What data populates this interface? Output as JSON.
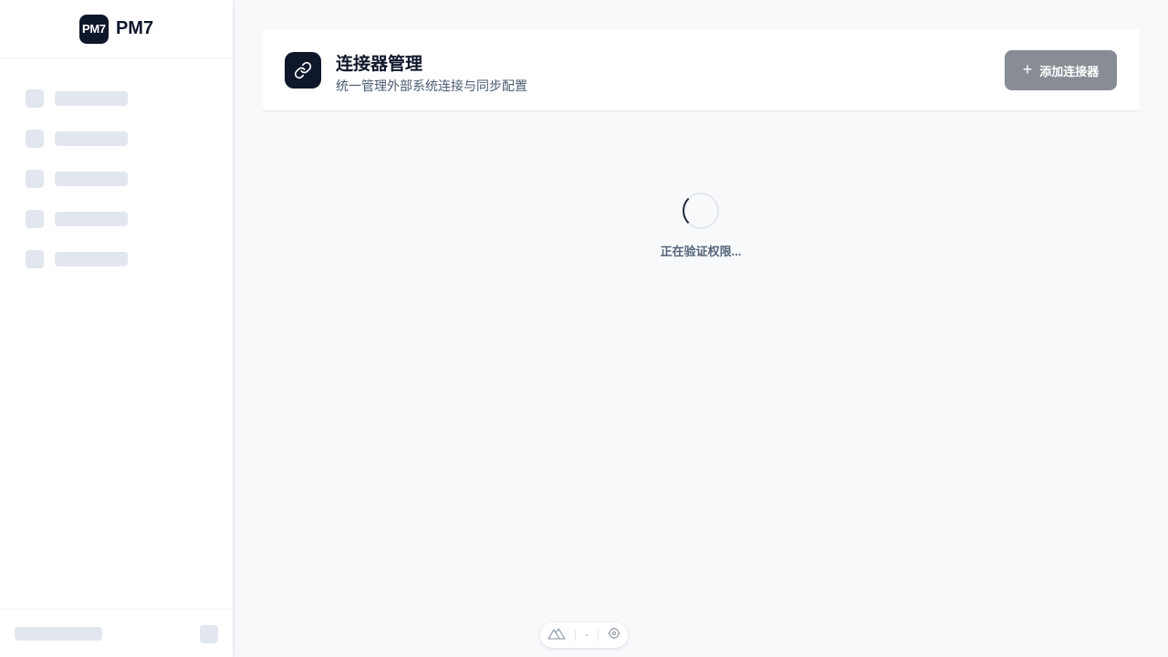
{
  "brand": {
    "logo_text": "PM7",
    "name": "PM7"
  },
  "sidebar": {
    "skeleton_items": 5,
    "loading": true
  },
  "header": {
    "icon": "link-icon",
    "title": "连接器管理",
    "subtitle": "统一管理外部系统连接与同步配置",
    "add_button_label": "添加连接器",
    "add_button_icon": "plus-icon"
  },
  "loading": {
    "text": "正在验证权限..."
  },
  "devbar": {
    "value": "-",
    "icons": [
      "nuxt-icon",
      "target-icon"
    ]
  },
  "colors": {
    "accent_dark": "#0f172a",
    "button_disabled": "#888c95",
    "skeleton": "#e2e7ef"
  }
}
